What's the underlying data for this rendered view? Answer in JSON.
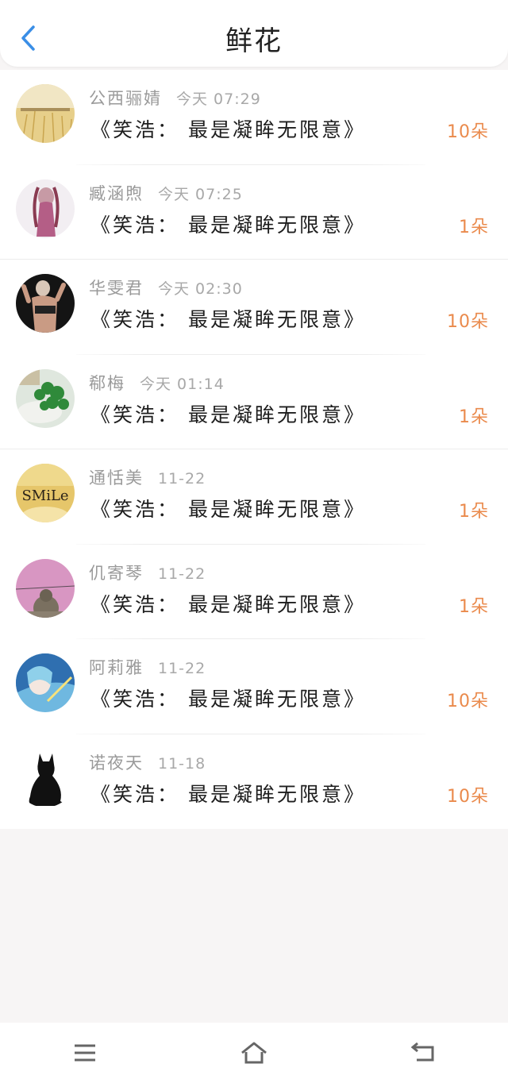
{
  "header": {
    "title": "鲜花"
  },
  "rows": [
    {
      "name": "公西骊婧",
      "time": "今天 07:29",
      "book": "《笑浩： 最是凝眸无限意》",
      "count": "10朵",
      "avatar": "avatar-wheat-field"
    },
    {
      "name": "臧涵煦",
      "time": "今天 07:25",
      "book": "《笑浩： 最是凝眸无限意》",
      "count": "1朵",
      "avatar": "avatar-girl"
    },
    {
      "name": "华雯君",
      "time": "今天 02:30",
      "book": "《笑浩： 最是凝眸无限意》",
      "count": "10朵",
      "avatar": "avatar-fitness"
    },
    {
      "name": "郗梅",
      "time": "今天 01:14",
      "book": "《笑浩： 最是凝眸无限意》",
      "count": "1朵",
      "avatar": "avatar-plant"
    },
    {
      "name": "通恬美",
      "time": "11-22",
      "book": "《笑浩： 最是凝眸无限意》",
      "count": "1朵",
      "avatar": "avatar-smile"
    },
    {
      "name": "仉寄琴",
      "time": "11-22",
      "book": "《笑浩： 最是凝眸无限意》",
      "count": "1朵",
      "avatar": "avatar-pink-sky"
    },
    {
      "name": "阿莉雅",
      "time": "11-22",
      "book": "《笑浩： 最是凝眸无限意》",
      "count": "10朵",
      "avatar": "avatar-anime"
    },
    {
      "name": "诺夜天",
      "time": "11-18",
      "book": "《笑浩： 最是凝眸无限意》",
      "count": "10朵",
      "avatar": "avatar-black-cat"
    }
  ],
  "avatar_texts": {
    "smile": "SMiLe"
  },
  "colors": {
    "accent": "#ea8a4c",
    "back": "#3a8ee6"
  }
}
